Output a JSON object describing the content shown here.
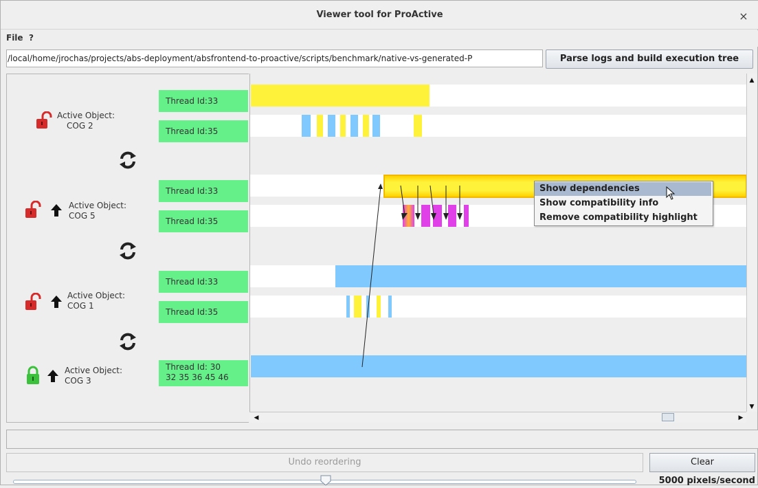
{
  "window": {
    "title": "Viewer tool for ProActive",
    "close_glyph": "×"
  },
  "menu": {
    "file": "File",
    "help": "?"
  },
  "toolbar": {
    "path_value": "/local/home/jrochas/projects/abs-deployment/absfrontend-to-proactive/scripts/benchmark/native-vs-generated-P",
    "parse_button": "Parse logs and build execution tree"
  },
  "active_objects": [
    {
      "label": "Active Object:",
      "name": "COG 2",
      "lock": "unlocked",
      "has_up_arrow": false,
      "threads": [
        "Thread Id:33",
        "Thread Id:35"
      ]
    },
    {
      "label": "Active Object:",
      "name": "COG 5",
      "lock": "unlocked",
      "has_up_arrow": true,
      "threads": [
        "Thread Id:33",
        "Thread Id:35"
      ]
    },
    {
      "label": "Active Object:",
      "name": "COG 1",
      "lock": "unlocked",
      "has_up_arrow": true,
      "threads": [
        "Thread Id:33",
        "Thread Id:35"
      ]
    },
    {
      "label": "Active Object:",
      "name": "COG 3",
      "lock": "locked",
      "has_up_arrow": true,
      "threads": [
        "Thread Id: 30\n32 35 36 45 46"
      ]
    }
  ],
  "icons": {
    "lock_open": "lock-open-icon",
    "lock_closed": "lock-closed-icon",
    "reorder": "swap-arrows-icon",
    "up_arrow": "up-arrow-icon"
  },
  "context_menu": {
    "items": [
      "Show dependencies",
      "Show compatibility info",
      "Remove compatibility highlight"
    ],
    "highlighted_index": 0
  },
  "bottom": {
    "undo_button": "Undo reordering",
    "clear_button": "Clear",
    "speed_label": "5000 pixels/second",
    "slider_position": 0.5
  },
  "colors": {
    "thread_label": "#66f08a",
    "bar_yellow": "#fff23a",
    "bar_blue": "#80c9ff",
    "bar_magenta": "#e040e8",
    "lock_red": "#d62b2b",
    "lock_green": "#3cc13c"
  }
}
